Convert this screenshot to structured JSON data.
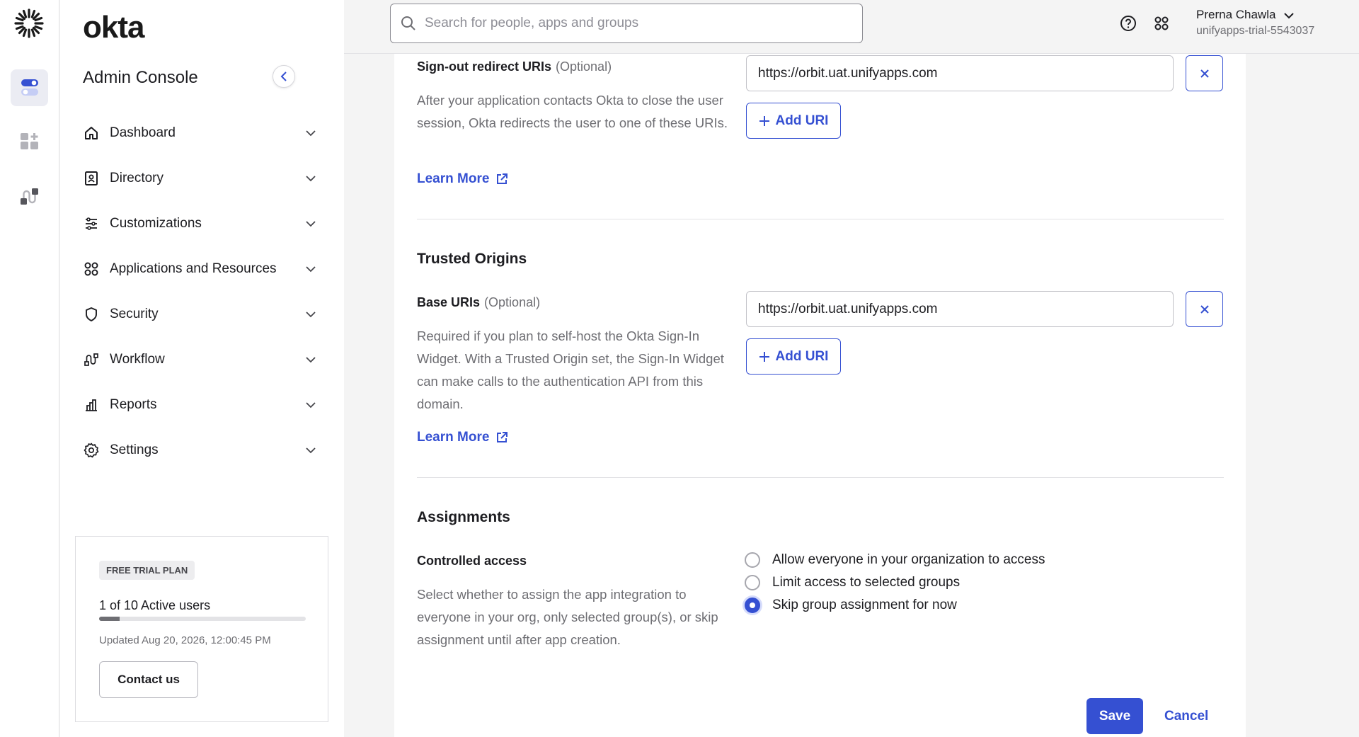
{
  "brand": {
    "name": "okta",
    "console_title": "Admin Console"
  },
  "rail": {
    "items": [
      "dashboard-toggle-icon",
      "add-app-icon",
      "workflow-icon"
    ]
  },
  "nav": {
    "items": [
      {
        "label": "Dashboard",
        "icon": "home-icon"
      },
      {
        "label": "Directory",
        "icon": "directory-icon"
      },
      {
        "label": "Customizations",
        "icon": "sliders-icon"
      },
      {
        "label": "Applications and Resources",
        "icon": "grid-icon"
      },
      {
        "label": "Security",
        "icon": "shield-icon"
      },
      {
        "label": "Workflow",
        "icon": "workflow-icon"
      },
      {
        "label": "Reports",
        "icon": "bar-chart-icon"
      },
      {
        "label": "Settings",
        "icon": "gear-icon"
      }
    ]
  },
  "trial": {
    "badge": "FREE TRIAL PLAN",
    "users": "1 of 10 Active users",
    "progress": 0.1,
    "updated": "Updated Aug 20, 2026, 12:00:45 PM",
    "contact": "Contact us"
  },
  "topbar": {
    "search_placeholder": "Search for people, apps and groups",
    "user_name": "Prerna Chawla",
    "org": "unifyapps-trial-5543037"
  },
  "signout": {
    "label": "Sign-out redirect URIs",
    "optional": "(Optional)",
    "description": "After your application contacts Okta to close the user session, Okta redirects the user to one of these URIs.",
    "uri": "https://orbit.uat.unifyapps.com",
    "add": "Add URI",
    "learn": "Learn More"
  },
  "trusted": {
    "title": "Trusted Origins",
    "label": "Base URIs",
    "optional": "(Optional)",
    "description": "Required if you plan to self-host the Okta Sign-In Widget. With a Trusted Origin set, the Sign-In Widget can make calls to the authentication API from this domain.",
    "uri": "https://orbit.uat.unifyapps.com",
    "add": "Add URI",
    "learn": "Learn More"
  },
  "assignments": {
    "title": "Assignments",
    "label": "Controlled access",
    "description": "Select whether to assign the app integration to everyone in your org, only selected group(s), or skip assignment until after app creation.",
    "options": [
      {
        "label": "Allow everyone in your organization to access",
        "checked": false
      },
      {
        "label": "Limit access to selected groups",
        "checked": false
      },
      {
        "label": "Skip group assignment for now",
        "checked": true
      }
    ]
  },
  "actions": {
    "save": "Save",
    "cancel": "Cancel"
  },
  "colors": {
    "accent": "#3550d2",
    "muted_text": "#6e6e73"
  }
}
